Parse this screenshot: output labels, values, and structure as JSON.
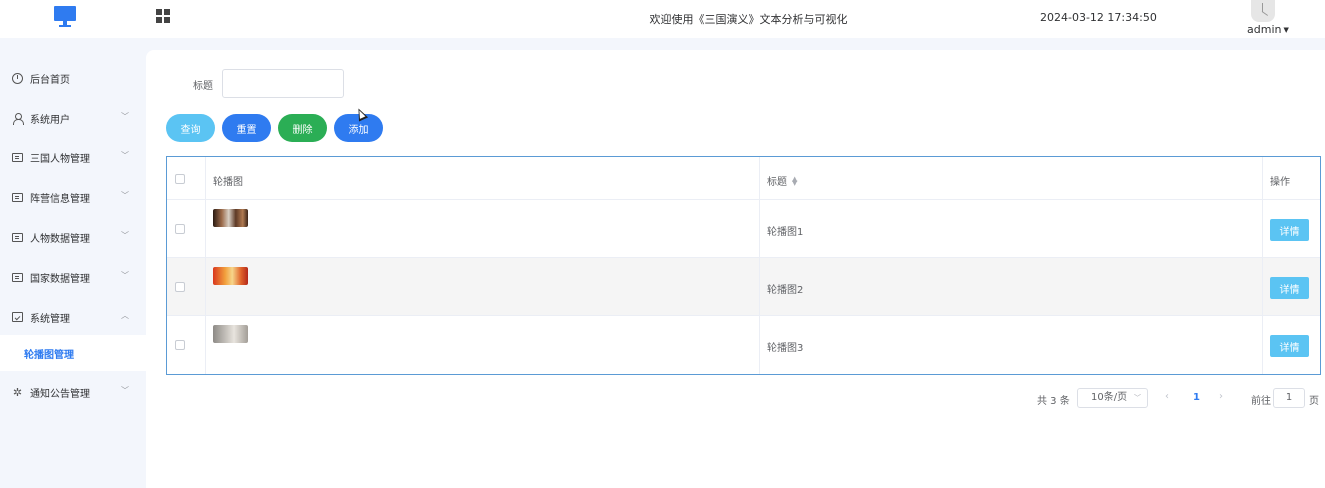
{
  "header": {
    "title": "欢迎使用《三国演义》文本分析与可视化",
    "datetime": "2024-03-12 17:34:50",
    "user": "admin",
    "logo_icon": "monitor-icon",
    "toggle_icon": "grid-icon"
  },
  "sidebar": {
    "items": [
      {
        "label": "后台首页",
        "icon": "pie-chart-icon"
      },
      {
        "label": "系统用户",
        "icon": "user-icon"
      },
      {
        "label": "三国人物管理",
        "icon": "card-icon"
      },
      {
        "label": "阵营信息管理",
        "icon": "card-icon"
      },
      {
        "label": "人物数据管理",
        "icon": "card-icon"
      },
      {
        "label": "国家数据管理",
        "icon": "card-icon"
      },
      {
        "label": "系统管理",
        "icon": "check-square-icon",
        "expanded": true
      },
      {
        "label": "通知公告管理",
        "icon": "sparkle-icon"
      }
    ],
    "active_subitem": "轮播图管理"
  },
  "search": {
    "label": "标题",
    "value": ""
  },
  "buttons": {
    "query": "查询",
    "reset": "重置",
    "delete": "删除",
    "add": "添加"
  },
  "table": {
    "columns": [
      "轮播图",
      "标题",
      "操作"
    ],
    "rows": [
      {
        "title": "轮播图1",
        "action": "详情"
      },
      {
        "title": "轮播图2",
        "action": "详情"
      },
      {
        "title": "轮播图3",
        "action": "详情"
      }
    ]
  },
  "pagination": {
    "total": "共 3 条",
    "page_size": "10条/页",
    "current_page": "1",
    "goto_label": "前往",
    "goto_value": "1",
    "page_suffix": "页"
  },
  "colors": {
    "primary": "#2f7bf0",
    "info": "#5bc4f3",
    "success": "#2bae55",
    "sidebar_bg": "#f3f6fc"
  }
}
